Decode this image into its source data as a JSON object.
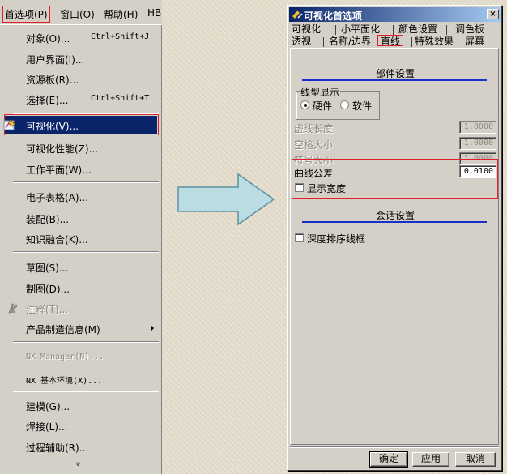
{
  "menubar": {
    "items": [
      "首选项(P)",
      "窗口(O)",
      "帮助(H)",
      "HB"
    ]
  },
  "menu": {
    "items": [
      {
        "label": "对象(O)...",
        "shortcut": "Ctrl+Shift+J"
      },
      {
        "label": "用户界面(I)..."
      },
      {
        "label": "资源板(R)..."
      },
      {
        "label": "选择(E)...",
        "shortcut": "Ctrl+Shift+T"
      },
      {
        "label": "可视化(V)..."
      },
      {
        "label": "可视化性能(Z)..."
      },
      {
        "label": "工作平面(W)..."
      },
      {
        "label": "电子表格(A)..."
      },
      {
        "label": "装配(B)..."
      },
      {
        "label": "知识融合(K)..."
      },
      {
        "label": "草图(S)..."
      },
      {
        "label": "制图(D)..."
      },
      {
        "label": "注释(T)..."
      },
      {
        "label": "产品制造信息(M)"
      },
      {
        "label": "NX Manager(N)..."
      },
      {
        "label": "NX 基本环境(X)..."
      },
      {
        "label": "建模(G)..."
      },
      {
        "label": "焊接(L)..."
      },
      {
        "label": "过程辅助(R)..."
      }
    ],
    "more": "»"
  },
  "dialog": {
    "title": "可视化首选项",
    "close": "×",
    "tabs_row1": [
      "可视化",
      "小平面化",
      "颜色设置",
      "调色板"
    ],
    "tabs_row2": [
      "透视",
      "名称/边界",
      "直线",
      "特殊效果",
      "屏幕"
    ],
    "section1": "部件设置",
    "line_display": {
      "group_label": "线型显示",
      "options": [
        "硬件",
        "软件"
      ],
      "selected": "硬件"
    },
    "fields": [
      {
        "label": "虚线长度",
        "value": "1.0000",
        "disabled": true
      },
      {
        "label": "空格大小",
        "value": "1.0000",
        "disabled": true
      },
      {
        "label": "符号大小",
        "value": "1.0000",
        "disabled": true
      },
      {
        "label": "曲线公差",
        "value": "0.0100",
        "disabled": false
      }
    ],
    "show_width": {
      "label": "显示宽度",
      "checked": false
    },
    "section2": "会话设置",
    "depth_sort": {
      "label": "深度排序线框",
      "checked": false
    },
    "buttons": {
      "ok": "确定",
      "apply": "应用",
      "cancel": "取消"
    }
  },
  "colors": {
    "selection": "#0a246a",
    "highlight": "#e0202a",
    "section_line": "#1a2ec8",
    "arrow_fill": "#b9dde3",
    "arrow_stroke": "#5f8fa0"
  }
}
